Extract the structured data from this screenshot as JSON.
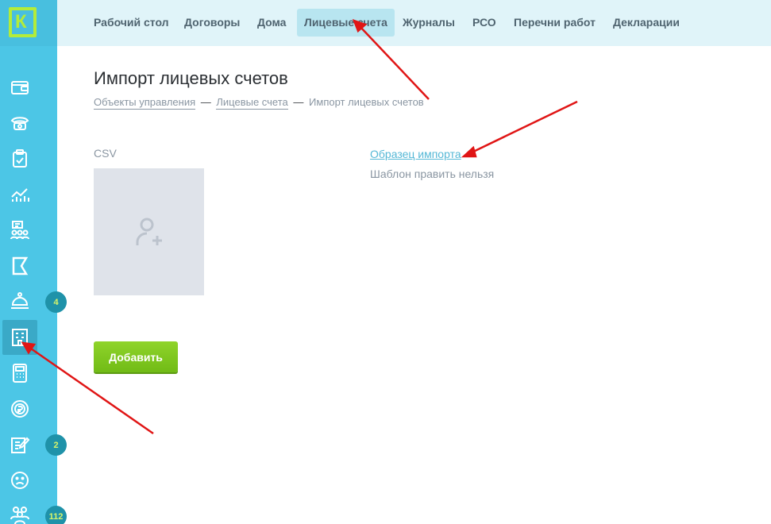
{
  "app": {
    "logo_letter": "К"
  },
  "sidebar": {
    "items": [
      {
        "name": "wallet"
      },
      {
        "name": "phone"
      },
      {
        "name": "clipboard"
      },
      {
        "name": "chart"
      },
      {
        "name": "people-list"
      },
      {
        "name": "flag"
      },
      {
        "name": "bell-service",
        "badge": "4"
      },
      {
        "name": "building",
        "active": true
      },
      {
        "name": "calculator"
      },
      {
        "name": "money"
      },
      {
        "name": "edit-doc",
        "badge": "2"
      },
      {
        "name": "sad-face"
      },
      {
        "name": "group",
        "badge": "112"
      }
    ]
  },
  "topnav": {
    "tabs": [
      {
        "label": "Рабочий стол"
      },
      {
        "label": "Договоры"
      },
      {
        "label": "Дома"
      },
      {
        "label": "Лицевые счета",
        "active": true
      },
      {
        "label": "Журналы"
      },
      {
        "label": "РСО"
      },
      {
        "label": "Перечни работ"
      },
      {
        "label": "Декларации"
      }
    ]
  },
  "page": {
    "title": "Импорт лицевых счетов",
    "breadcrumb": {
      "item1": "Объекты управления",
      "sep": "—",
      "item2": "Лицевые счета",
      "current": "Импорт лицевых счетов"
    },
    "csv_label": "CSV",
    "sample_link": "Образец импорта",
    "sample_note": "Шаблон править нельзя",
    "add_button": "Добавить"
  },
  "colors": {
    "sidebar": "#4cc6e6",
    "accent_green": "#7fc91f",
    "badge": "#1f92a9",
    "link": "#55b8d6",
    "arrow": "#e01515"
  }
}
